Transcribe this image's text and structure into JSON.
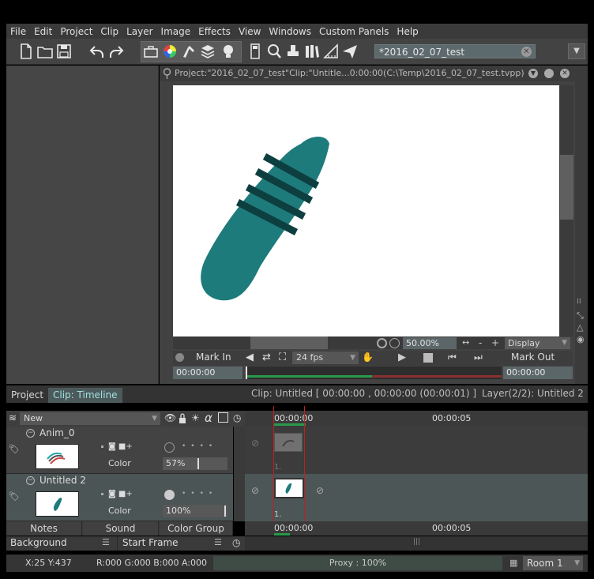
{
  "menu": [
    "File",
    "Edit",
    "Project",
    "Clip",
    "Layer",
    "Image",
    "Effects",
    "View",
    "Windows",
    "Custom Panels",
    "Help"
  ],
  "toolbar": {
    "project_name": "*2016_02_07_test"
  },
  "viewer": {
    "title": "Project:\"2016_02_07_test\"Clip:\"Untitle...0:00:00(C:\\Temp\\2016_02_07_test.tvpp)",
    "zoom": "50.00%",
    "minus": "-",
    "plus": "+",
    "display": "Display",
    "mark_in": "Mark In",
    "mark_out": "Mark Out",
    "fps": "24 fps",
    "tc_in": "00:00:00",
    "tc_out": "00:00:00"
  },
  "timeline": {
    "tab_project": "Project",
    "tab_clip": "Clip: Timeline",
    "clip_info": "Clip: Untitled [ 00:00:00 , 00:00:00  (00:00:01) ]",
    "layer_info": "Layer(2/2): Untitled 2",
    "new_label": "New",
    "ruler_start": "00:00:00",
    "ruler_mid": "00:00:05",
    "frame_label": "1.",
    "alpha_glyph": "α",
    "layers": [
      {
        "name": "Anim_0",
        "color_label": "Color",
        "opacity": "57%",
        "opacity_pct": 57
      },
      {
        "name": "Untitled 2",
        "color_label": "Color",
        "opacity": "100%",
        "opacity_pct": 100
      }
    ]
  },
  "bottom": {
    "notes": "Notes",
    "sound": "Sound",
    "color_group": "Color Group",
    "background": "Background",
    "start_frame": "Start Frame"
  },
  "status": {
    "coords": "X:25  Y:437",
    "rgba": "R:000 G:000 B:000 A:000",
    "proxy": "Proxy : 100%",
    "room": "Room 1"
  },
  "colors": {
    "accent": "#1e7b7b",
    "stripe": "#0e3f40",
    "panel": "#434343"
  }
}
